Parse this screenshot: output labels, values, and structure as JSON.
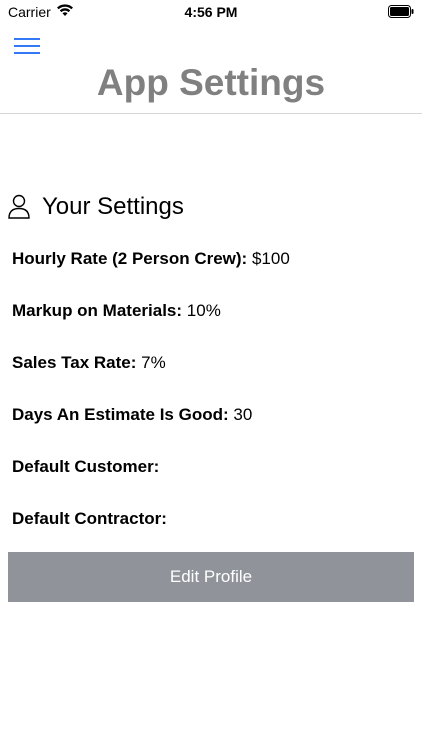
{
  "status_bar": {
    "carrier": "Carrier",
    "time": "4:56 PM"
  },
  "header": {
    "title": "App Settings"
  },
  "section": {
    "title": "Your Settings",
    "icon": "user-icon"
  },
  "settings": [
    {
      "label": "Hourly Rate (2 Person Crew):",
      "value": "$100"
    },
    {
      "label": "Markup on Materials:",
      "value": "10%"
    },
    {
      "label": "Sales Tax Rate:",
      "value": "7%"
    },
    {
      "label": "Days An Estimate Is Good:",
      "value": "30"
    },
    {
      "label": "Default Customer:",
      "value": ""
    },
    {
      "label": "Default Contractor:",
      "value": ""
    }
  ],
  "actions": {
    "edit_profile_label": "Edit Profile"
  },
  "colors": {
    "accent": "#3478f6",
    "title_gray": "#808080",
    "button_gray": "#909399"
  }
}
